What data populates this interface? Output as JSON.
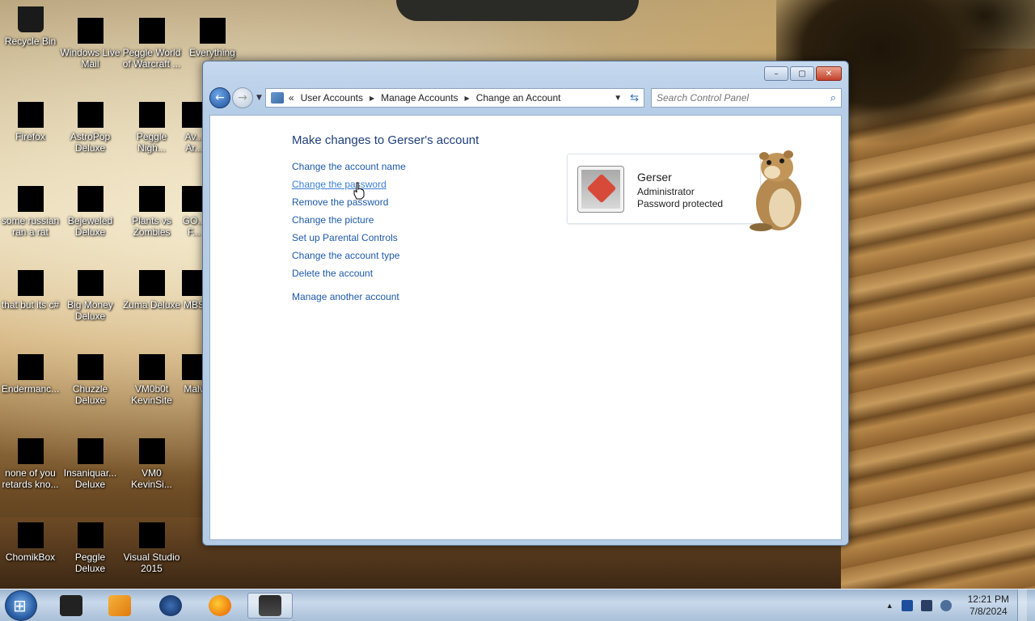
{
  "desktop": {
    "icons": [
      {
        "label": "Recycle Bin"
      },
      {
        "label": "Windows Live Mail"
      },
      {
        "label": "Peggle World of Warcraft ..."
      },
      {
        "label": "Everything"
      },
      {
        "label": "Firefox"
      },
      {
        "label": "AstroPop Deluxe"
      },
      {
        "label": "Peggle Nigh..."
      },
      {
        "label": "Av... Ar..."
      },
      {
        "label": "some russian ran a rat"
      },
      {
        "label": "Bejeweled Deluxe"
      },
      {
        "label": "Plants vs Zombies"
      },
      {
        "label": "GO... F..."
      },
      {
        "label": "that but its c#"
      },
      {
        "label": "Big Money Deluxe"
      },
      {
        "label": "Zuma Deluxe"
      },
      {
        "label": "MBS"
      },
      {
        "label": "Endermanc..."
      },
      {
        "label": "Chuzzle Deluxe"
      },
      {
        "label": "VM0b0t KevinSite"
      },
      {
        "label": "Malv"
      },
      {
        "label": "none of you retards kno..."
      },
      {
        "label": "Insaniquar... Deluxe"
      },
      {
        "label": "VM0 KevinSi..."
      },
      {
        "label": "ChomikBox"
      },
      {
        "label": "Peggle Deluxe"
      },
      {
        "label": "Visual Studio 2015"
      }
    ]
  },
  "window": {
    "controls": {
      "minimize": "–",
      "maximize": "▢",
      "close": "✕"
    },
    "breadcrumb": {
      "prefix": "«",
      "items": [
        "User Accounts",
        "Manage Accounts",
        "Change an Account"
      ],
      "separator": "▶"
    },
    "search_placeholder": "Search Control Panel",
    "heading": "Make changes to Gerser's account",
    "links": [
      "Change the account name",
      "Change the password",
      "Remove the password",
      "Change the picture",
      "Set up Parental Controls",
      "Change the account type",
      "Delete the account"
    ],
    "extra_link": "Manage another account",
    "account": {
      "name": "Gerser",
      "type": "Administrator",
      "status": "Password protected"
    }
  },
  "taskbar": {
    "clock_time": "12:21 PM",
    "clock_date": "7/8/2024",
    "tray_arrow": "▲"
  },
  "colors": {
    "link": "#1e5aa8",
    "heading": "#1e3f7a",
    "taskbar": "#b6cbe2"
  }
}
